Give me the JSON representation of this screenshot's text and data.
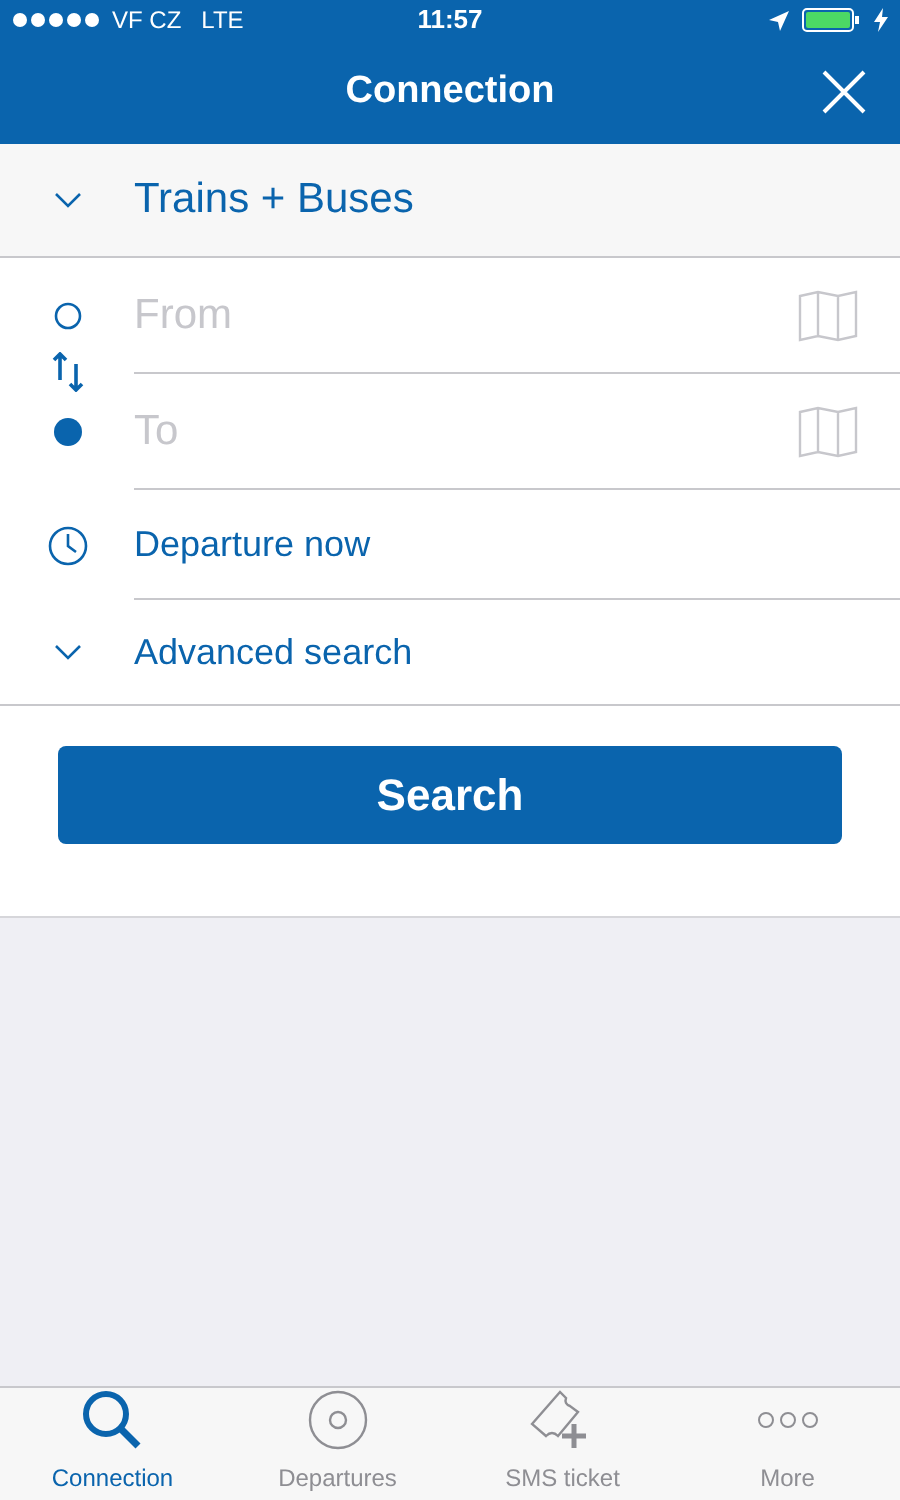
{
  "status_bar": {
    "carrier": "VF CZ",
    "network": "LTE",
    "time": "11:57"
  },
  "header": {
    "title": "Connection"
  },
  "mode": {
    "label": "Trains + Buses",
    "expanded": false
  },
  "route": [
    {
      "kind": "from",
      "placeholder": "From"
    },
    {
      "kind": "to",
      "placeholder": "To"
    }
  ],
  "departure": {
    "label": "Departure now"
  },
  "advanced": {
    "label": "Advanced search",
    "expanded": false
  },
  "search_button": {
    "label": "Search"
  },
  "tab_bar": [
    {
      "kind": "search",
      "label": "Connection",
      "selected": true
    },
    {
      "kind": "departures",
      "label": "Departures",
      "selected": false
    },
    {
      "kind": "ticket",
      "label": "SMS ticket",
      "selected": false
    },
    {
      "kind": "more",
      "label": "More",
      "selected": false
    }
  ]
}
